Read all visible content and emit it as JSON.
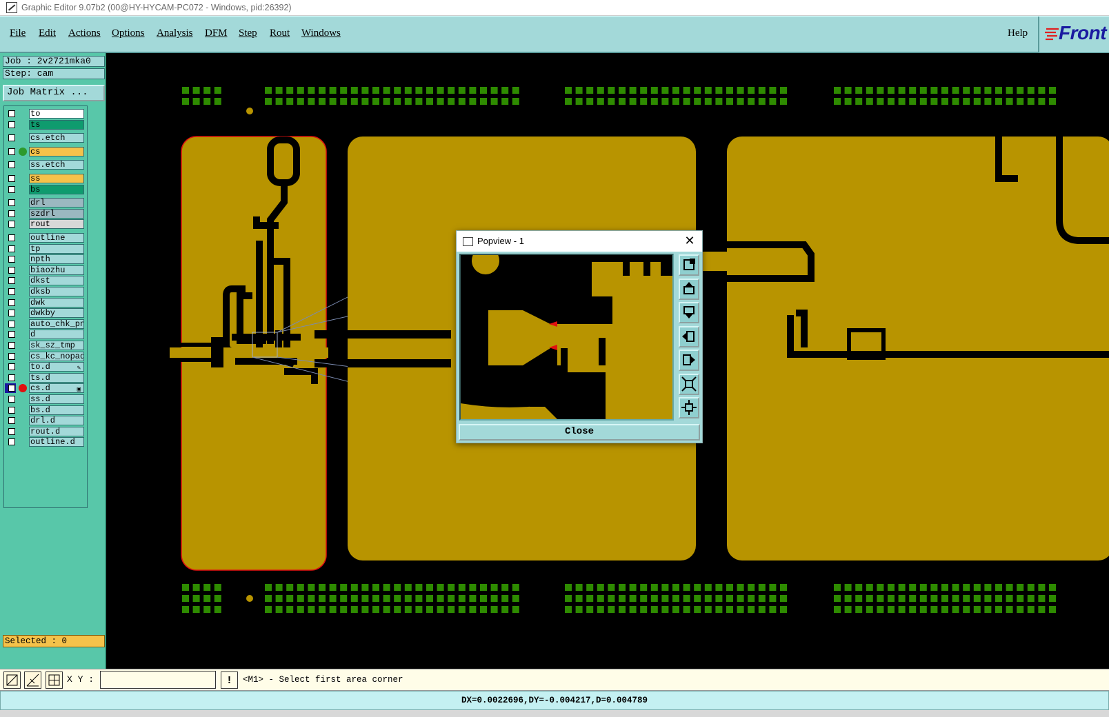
{
  "window": {
    "title": "Graphic Editor 9.07b2 (00@HY-HYCAM-PC072 - Windows, pid:26392)"
  },
  "menubar": {
    "items": [
      {
        "label": "File"
      },
      {
        "label": "Edit"
      },
      {
        "label": "Actions"
      },
      {
        "label": "Options"
      },
      {
        "label": "Analysis"
      },
      {
        "label": "DFM"
      },
      {
        "label": "Step"
      },
      {
        "label": "Rout"
      },
      {
        "label": "Windows"
      }
    ],
    "help": "Help",
    "logo": "Front"
  },
  "leftpanel": {
    "job": "Job : 2v2721mka0",
    "step": "Step: cam",
    "job_matrix": "Job Matrix ...",
    "selected": "Selected : 0",
    "layers": [
      {
        "name": "to",
        "color": "#ffffff"
      },
      {
        "name": "ts",
        "color": "#0f9b6e"
      },
      {
        "name": "cs.etch",
        "color": "#a3d9d9"
      },
      {
        "name": "cs",
        "color": "#f5c24a",
        "dot": "#2c9a2c"
      },
      {
        "name": "ss.etch",
        "color": "#a3d9d9"
      },
      {
        "name": "ss",
        "color": "#f5c24a"
      },
      {
        "name": "bs",
        "color": "#0f9b6e"
      },
      {
        "name": "drl",
        "color": "#9bb8c0"
      },
      {
        "name": "szdrl",
        "color": "#9bb8c0"
      },
      {
        "name": "rout",
        "color": "#d8d8d8"
      },
      {
        "name": "outline",
        "color": "#a3d9d9"
      },
      {
        "name": "tp",
        "color": "#a3d9d9"
      },
      {
        "name": "npth",
        "color": "#a3d9d9"
      },
      {
        "name": "biaozhu",
        "color": "#a3d9d9"
      },
      {
        "name": "dkst",
        "color": "#a3d9d9"
      },
      {
        "name": "dksb",
        "color": "#a3d9d9"
      },
      {
        "name": "dwk",
        "color": "#a3d9d9"
      },
      {
        "name": "dwkby",
        "color": "#a3d9d9"
      },
      {
        "name": "auto_chk_pn",
        "color": "#a3d9d9"
      },
      {
        "name": "d",
        "color": "#a3d9d9"
      },
      {
        "name": "sk_sz_tmp",
        "color": "#a3d9d9"
      },
      {
        "name": "cs_kc_nopad",
        "color": "#a3d9d9"
      },
      {
        "name": "to.d",
        "color": "#a3d9d9",
        "flag": "✎"
      },
      {
        "name": "ts.d",
        "color": "#a3d9d9"
      },
      {
        "name": "cs.d",
        "color": "#a3d9d9",
        "dot": "#e01010",
        "selected": true,
        "flag": "▣"
      },
      {
        "name": "ss.d",
        "color": "#a3d9d9"
      },
      {
        "name": "bs.d",
        "color": "#a3d9d9"
      },
      {
        "name": "drl.d",
        "color": "#a3d9d9"
      },
      {
        "name": "rout.d",
        "color": "#a3d9d9"
      },
      {
        "name": "outline.d",
        "color": "#a3d9d9"
      }
    ]
  },
  "popview": {
    "title": "Popview - 1",
    "close_label": "Close",
    "tools": [
      "zoom-window-icon",
      "pan-up-icon",
      "pan-down-icon",
      "pan-left-icon",
      "pan-right-icon",
      "zoom-out-icon",
      "zoom-home-icon"
    ]
  },
  "cmdbar": {
    "xy_label": "X Y :",
    "xy_value": "",
    "prompt_icon": "!",
    "prompt": "<M1> - Select first area corner"
  },
  "statusbar": {
    "text": "DX=0.0022696,DY=-0.004217,D=0.004789"
  },
  "colors": {
    "copper": "#b89400",
    "pad": "#2e8b00",
    "panel": "#a3d9d9",
    "side": "#58c7a9",
    "outline": "#e01010"
  }
}
